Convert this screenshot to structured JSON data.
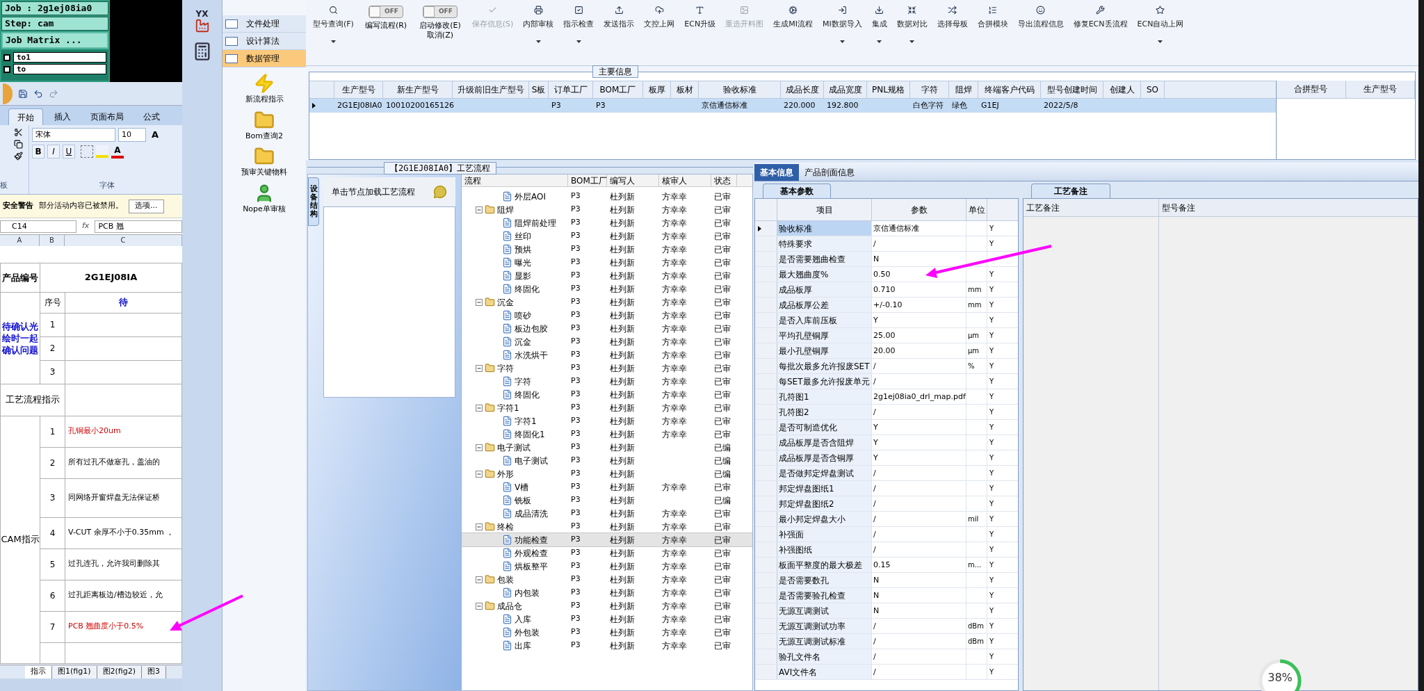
{
  "job_panel": {
    "job": "Job : 2g1ej08ia0",
    "step": "Step: cam",
    "matrix_button": "Job Matrix ...",
    "layers": [
      {
        "name": "to1",
        "checked": false
      },
      {
        "name": "to",
        "checked": false
      }
    ]
  },
  "spreadsheet": {
    "ribbon_tabs": [
      {
        "label": "开始",
        "selected": true
      },
      {
        "label": "插入",
        "selected": false
      },
      {
        "label": "页面布局",
        "selected": false
      },
      {
        "label": "公式",
        "selected": false
      }
    ],
    "clipboard_group_label": "板",
    "font_name": "宋体",
    "font_size": "10",
    "grow_font": "A",
    "format_buttons": [
      "B",
      "I",
      "U"
    ],
    "font_color": "A",
    "font_group_label": "字体",
    "security_warning": {
      "title": "安全警告",
      "message": "部分活动内容已被禁用。",
      "button": "选项..."
    },
    "cell_ref": "C14",
    "function_label": "fx",
    "formula": "PCB 翘",
    "columns": [
      "A",
      "B",
      "C"
    ],
    "product_label": "产品编号",
    "product_code": "2G1EJ08IA",
    "confirm_label": "待确认光绘时一起确认问题",
    "seq_heading": "序号",
    "confirm_heading": "待",
    "confirm_rows": [
      "1",
      "2",
      "3"
    ],
    "flow_label": "工艺流程指示",
    "cam_label": "CAM指示",
    "cam_rows": [
      {
        "no": "1",
        "text": "孔铜最小20um",
        "highlight": true
      },
      {
        "no": "2",
        "text": "所有过孔不做塞孔，盖油的",
        "highlight": false
      },
      {
        "no": "3",
        "text": "同网络开窗焊盘无法保证桥",
        "highlight": false
      },
      {
        "no": "4",
        "text": "V-CUT 余厚不小于0.35mm ，",
        "highlight": false
      },
      {
        "no": "5",
        "text": "过孔连孔，允许我司删除其",
        "highlight": false
      },
      {
        "no": "6",
        "text": "过孔距离板边/槽边较近，允",
        "highlight": false
      },
      {
        "no": "7",
        "text": "PCB 翘曲度小于0.5%",
        "highlight": true
      }
    ],
    "sheet_tabs": [
      {
        "label": "指示",
        "selected": true
      },
      {
        "label": "图1(fig1)",
        "selected": false
      },
      {
        "label": "图2(fig2)",
        "selected": false
      },
      {
        "label": "图3",
        "selected": false
      }
    ]
  },
  "sidebar": {
    "logo_text": "YX",
    "sections": [
      {
        "label": "文件处理",
        "selected": false
      },
      {
        "label": "设计算法",
        "selected": false
      },
      {
        "label": "数据管理",
        "selected": true
      }
    ],
    "tools": [
      {
        "label": "新流程指示",
        "kind": "bolt"
      },
      {
        "label": "Bom查询2",
        "kind": "folder"
      },
      {
        "label": "预审关键物料",
        "kind": "folder"
      },
      {
        "label": "Nope单审核",
        "kind": "user"
      }
    ]
  },
  "toolbar": [
    {
      "kind": "button",
      "label": "型号查询(F)",
      "dropdown": true,
      "disabled": false
    },
    {
      "kind": "toggle",
      "label": "编写流程(R)",
      "switch_text": "OFF",
      "on": false
    },
    {
      "kind": "toggle",
      "label": "启动修改(E)",
      "sublabel": "取消(Z)",
      "switch_text": "OFF",
      "on": false
    },
    {
      "kind": "button",
      "label": "保存信息(S)",
      "dropdown": false,
      "disabled": true
    },
    {
      "kind": "button",
      "label": "内部审核",
      "dropdown": true,
      "disabled": false
    },
    {
      "kind": "button",
      "label": "指示检查",
      "dropdown": true,
      "disabled": false
    },
    {
      "kind": "button",
      "label": "发送指示",
      "dropdown": false,
      "disabled": false
    },
    {
      "kind": "button",
      "label": "文控上网",
      "dropdown": false,
      "disabled": false
    },
    {
      "kind": "button",
      "label": "ECN升级",
      "dropdown": false,
      "disabled": false
    },
    {
      "kind": "button",
      "label": "重选开料图",
      "dropdown": false,
      "disabled": true
    },
    {
      "kind": "button",
      "label": "生成MI流程",
      "dropdown": false,
      "disabled": false
    },
    {
      "kind": "button",
      "label": "MI数据导入",
      "dropdown": true,
      "disabled": false
    },
    {
      "kind": "button",
      "label": "集成",
      "dropdown": true,
      "disabled": false
    },
    {
      "kind": "button",
      "label": "数据对比",
      "dropdown": true,
      "disabled": false
    },
    {
      "kind": "button",
      "label": "选择母板",
      "dropdown": false,
      "disabled": false
    },
    {
      "kind": "button",
      "label": "合拼模块",
      "dropdown": false,
      "disabled": false
    },
    {
      "kind": "button",
      "label": "导出流程信息",
      "dropdown": false,
      "disabled": false
    },
    {
      "kind": "button",
      "label": "修复ECN丢流程",
      "dropdown": false,
      "disabled": false
    },
    {
      "kind": "button",
      "label": "ECN自动上网",
      "dropdown": true,
      "disabled": false
    }
  ],
  "main_info": {
    "title": "主要信息",
    "columns": [
      "生产型号",
      "新生产型号",
      "升级前旧生产型号",
      "S板",
      "订单工厂",
      "BOM工厂",
      "板厚",
      "板材",
      "验收标准",
      "成品长度",
      "成品宽度",
      "PNL规格",
      "字符",
      "阻焊",
      "终端客户代码",
      "型号创建时间",
      "创建人",
      "SO"
    ],
    "rows": [
      {
        "selected": true,
        "cells": [
          "2G1EJ08IA0",
          "10010200165126",
          null,
          null,
          "P3",
          "P3",
          null,
          null,
          "京信通信标准",
          "220.000",
          "192.800",
          null,
          "白色字符",
          "绿色",
          "G1EJ",
          "2022/5/8",
          null,
          null
        ]
      }
    ],
    "merge_columns": [
      "合拼型号",
      "生产型号"
    ]
  },
  "process": {
    "title": "【2G1EJ08IA0】工艺流程",
    "side_tab": "设备结构",
    "hint": "单击节点加载工艺流程",
    "columns": [
      "流程",
      "BOM工厂",
      "编写人",
      "核审人",
      "状态"
    ],
    "tree": [
      {
        "children": [
          {
            "label": "外层AOI",
            "bom": "P3",
            "writer": "杜列新",
            "reviewer": "方幸幸",
            "status": "已审",
            "selected": false
          }
        ]
      },
      {
        "label": "阻焊",
        "bom": "P3",
        "writer": "杜列新",
        "reviewer": "方幸幸",
        "status": "已审",
        "selected": false,
        "expanded": true,
        "children": [
          {
            "label": "阻焊前处理",
            "bom": "P3",
            "writer": "杜列新",
            "reviewer": "方幸幸",
            "status": "已审",
            "selected": false
          },
          {
            "label": "丝印",
            "bom": "P3",
            "writer": "杜列新",
            "reviewer": "方幸幸",
            "status": "已审",
            "selected": false
          },
          {
            "label": "预烘",
            "bom": "P3",
            "writer": "杜列新",
            "reviewer": "方幸幸",
            "status": "已审",
            "selected": false
          },
          {
            "label": "曝光",
            "bom": "P3",
            "writer": "杜列新",
            "reviewer": "方幸幸",
            "status": "已审",
            "selected": false
          },
          {
            "label": "显影",
            "bom": "P3",
            "writer": "杜列新",
            "reviewer": "方幸幸",
            "status": "已审",
            "selected": false
          },
          {
            "label": "终固化",
            "bom": "P3",
            "writer": "杜列新",
            "reviewer": "方幸幸",
            "status": "已审",
            "selected": false
          }
        ]
      },
      {
        "label": "沉金",
        "bom": "P3",
        "writer": "杜列新",
        "reviewer": "方幸幸",
        "status": "已审",
        "selected": false,
        "expanded": true,
        "children": [
          {
            "label": "喷砂",
            "bom": "P3",
            "writer": "杜列新",
            "reviewer": "方幸幸",
            "status": "已审",
            "selected": false
          },
          {
            "label": "板边包胶",
            "bom": "P3",
            "writer": "杜列新",
            "reviewer": "方幸幸",
            "status": "已审",
            "selected": false
          },
          {
            "label": "沉金",
            "bom": "P3",
            "writer": "杜列新",
            "reviewer": "方幸幸",
            "status": "已审",
            "selected": false
          },
          {
            "label": "水洗烘干",
            "bom": "P3",
            "writer": "杜列新",
            "reviewer": "方幸幸",
            "status": "已审",
            "selected": false
          }
        ]
      },
      {
        "label": "字符",
        "bom": "P3",
        "writer": "杜列新",
        "reviewer": "方幸幸",
        "status": "已审",
        "selected": false,
        "expanded": true,
        "children": [
          {
            "label": "字符",
            "bom": "P3",
            "writer": "杜列新",
            "reviewer": "方幸幸",
            "status": "已审",
            "selected": false
          },
          {
            "label": "终固化",
            "bom": "P3",
            "writer": "杜列新",
            "reviewer": "方幸幸",
            "status": "已审",
            "selected": false
          }
        ]
      },
      {
        "label": "字符1",
        "bom": "P3",
        "writer": "杜列新",
        "reviewer": "方幸幸",
        "status": "已审",
        "selected": false,
        "expanded": true,
        "children": [
          {
            "label": "字符1",
            "bom": "P3",
            "writer": "杜列新",
            "reviewer": "方幸幸",
            "status": "已审",
            "selected": false
          },
          {
            "label": "终固化1",
            "bom": "P3",
            "writer": "杜列新",
            "reviewer": "方幸幸",
            "status": "已审",
            "selected": false
          }
        ]
      },
      {
        "label": "电子测试",
        "bom": "P3",
        "writer": "杜列新",
        "status": "已编",
        "selected": false,
        "expanded": true,
        "children": [
          {
            "label": "电子测试",
            "bom": "P3",
            "writer": "杜列新",
            "status": "已编",
            "selected": false
          }
        ]
      },
      {
        "label": "外形",
        "bom": "P3",
        "writer": "杜列新",
        "status": "已编",
        "selected": false,
        "expanded": true,
        "children": [
          {
            "label": "V槽",
            "bom": "P3",
            "writer": "杜列新",
            "reviewer": "方幸幸",
            "status": "已审",
            "selected": false
          },
          {
            "label": "铣板",
            "bom": "P3",
            "writer": "杜列新",
            "status": "已编",
            "selected": false
          },
          {
            "label": "成品清洗",
            "bom": "P3",
            "writer": "杜列新",
            "reviewer": "方幸幸",
            "status": "已审",
            "selected": false
          }
        ]
      },
      {
        "label": "终检",
        "bom": "P3",
        "writer": "杜列新",
        "reviewer": "方幸幸",
        "status": "已审",
        "selected": false,
        "expanded": true,
        "children": [
          {
            "label": "功能检查",
            "bom": "P3",
            "writer": "杜列新",
            "reviewer": "方幸幸",
            "status": "已审",
            "selected": true
          },
          {
            "label": "外观检查",
            "bom": "P3",
            "writer": "杜列新",
            "reviewer": "方幸幸",
            "status": "已审",
            "selected": false
          },
          {
            "label": "烘板整平",
            "bom": "P3",
            "writer": "杜列新",
            "reviewer": "方幸幸",
            "status": "已审",
            "selected": false
          }
        ]
      },
      {
        "label": "包装",
        "bom": "P3",
        "writer": "杜列新",
        "reviewer": "方幸幸",
        "status": "已审",
        "selected": false,
        "expanded": true,
        "children": [
          {
            "label": "内包装",
            "bom": "P3",
            "writer": "杜列新",
            "reviewer": "方幸幸",
            "status": "已审",
            "selected": false
          }
        ]
      },
      {
        "label": "成品仓",
        "bom": "P3",
        "writer": "杜列新",
        "reviewer": "方幸幸",
        "status": "已审",
        "selected": false,
        "expanded": true,
        "children": [
          {
            "label": "入库",
            "bom": "P3",
            "writer": "杜列新",
            "reviewer": "方幸幸",
            "status": "已审",
            "selected": false
          },
          {
            "label": "外包装",
            "bom": "P3",
            "writer": "杜列新",
            "reviewer": "方幸幸",
            "status": "已审",
            "selected": false
          },
          {
            "label": "出库",
            "bom": "P3",
            "writer": "杜列新",
            "reviewer": "方幸幸",
            "status": "已审",
            "selected": false
          }
        ]
      }
    ]
  },
  "details": {
    "tabs": [
      {
        "label": "基本信息",
        "selected": true
      },
      {
        "label": "产品剖面信息",
        "selected": false
      }
    ],
    "subtab": "基本参数",
    "columns": [
      "项目",
      "参数",
      "单位"
    ],
    "rows": [
      {
        "item": "验收标准",
        "value": "京信通信标准",
        "flag": "Y",
        "selected": true
      },
      {
        "item": "特殊要求",
        "value": "/",
        "flag": "Y",
        "selected": false
      },
      {
        "item": "是否需要翘曲检查",
        "value": "N",
        "selected": false
      },
      {
        "item": "最大翘曲度%",
        "value": "0.50",
        "flag": "Y",
        "selected": false
      },
      {
        "item": "成品板厚",
        "value": "0.710",
        "unit": "mm",
        "flag": "Y",
        "selected": false
      },
      {
        "item": "成品板厚公差",
        "value": "+/-0.10",
        "unit": "mm",
        "flag": "Y",
        "selected": false
      },
      {
        "item": "是否入库前压板",
        "value": "Y",
        "flag": "Y",
        "selected": false
      },
      {
        "item": "平均孔壁铜厚",
        "value": "25.00",
        "unit": "μm",
        "flag": "Y",
        "selected": false
      },
      {
        "item": "最小孔壁铜厚",
        "value": "20.00",
        "unit": "μm",
        "flag": "Y",
        "selected": false
      },
      {
        "item": "每批次最多允许报废SET",
        "value": "/",
        "unit": "%",
        "flag": "Y",
        "selected": false
      },
      {
        "item": "每SET最多允许报废单元",
        "value": "/",
        "flag": "Y",
        "selected": false
      },
      {
        "item": "孔符图1",
        "value": "2g1ej08ia0_drl_map.pdf",
        "flag": "Y",
        "selected": false
      },
      {
        "item": "孔符图2",
        "value": "/",
        "flag": "Y",
        "selected": false
      },
      {
        "item": "是否可制造优化",
        "value": "Y",
        "flag": "Y",
        "selected": false
      },
      {
        "item": "成品板厚是否含阻焊",
        "value": "Y",
        "flag": "Y",
        "selected": false
      },
      {
        "item": "成品板厚是否含铜厚",
        "value": "Y",
        "flag": "Y",
        "selected": false
      },
      {
        "item": "是否做邦定焊盘测试",
        "value": "/",
        "flag": "Y",
        "selected": false
      },
      {
        "item": "邦定焊盘图纸1",
        "value": "/",
        "flag": "Y",
        "selected": false
      },
      {
        "item": "邦定焊盘图纸2",
        "value": "/",
        "flag": "Y",
        "selected": false
      },
      {
        "item": "最小邦定焊盘大小",
        "value": "/",
        "unit": "mil",
        "flag": "Y",
        "selected": false
      },
      {
        "item": "补强面",
        "value": "/",
        "flag": "Y",
        "selected": false
      },
      {
        "item": "补强图纸",
        "value": "/",
        "flag": "Y",
        "selected": false
      },
      {
        "item": "板面平整度的最大极差",
        "value": "0.15",
        "unit": "m...",
        "flag": "Y",
        "selected": false
      },
      {
        "item": "是否需要数孔",
        "value": "N",
        "flag": "Y",
        "selected": false
      },
      {
        "item": "是否需要验孔检查",
        "value": "N",
        "flag": "Y",
        "selected": false
      },
      {
        "item": "无源互调测试",
        "value": "N",
        "flag": "Y",
        "selected": false
      },
      {
        "item": "无源互调测试功率",
        "value": "/",
        "unit": "dBm",
        "flag": "Y",
        "selected": false
      },
      {
        "item": "无源互调测试标准",
        "value": "/",
        "unit": "dBm",
        "flag": "Y",
        "selected": false
      },
      {
        "item": "验孔文件名",
        "value": "/",
        "flag": "Y",
        "selected": false
      },
      {
        "item": "AVI文件名",
        "value": "/",
        "flag": "Y",
        "selected": false
      }
    ],
    "notes_tab": "工艺备注",
    "notes_columns": [
      "工艺备注",
      "型号备注"
    ]
  },
  "progress": {
    "level": 0.38,
    "text": "38%"
  }
}
